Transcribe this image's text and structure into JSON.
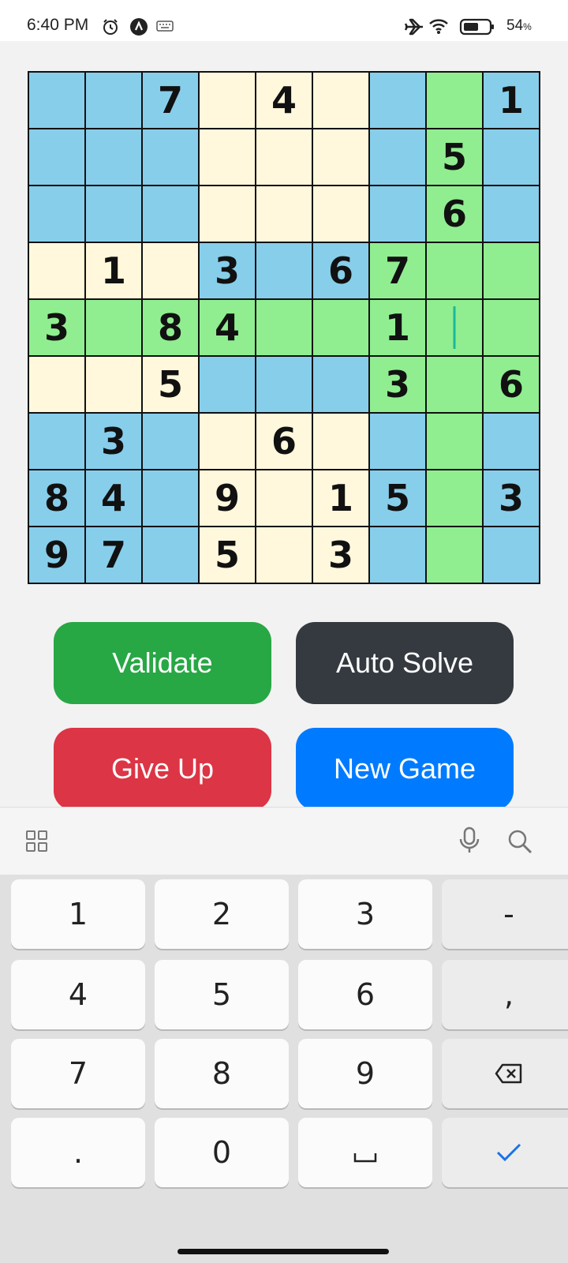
{
  "status_bar": {
    "time": "6:40 PM",
    "battery_percent": "54",
    "battery_unit": "%",
    "icons": [
      "alarm-icon",
      "notification-a-icon",
      "keyboard-icon",
      "airplane-icon",
      "wifi-icon",
      "battery-icon"
    ]
  },
  "board": {
    "rows": [
      [
        "",
        "",
        "7",
        "",
        "4",
        "",
        "",
        "",
        "1"
      ],
      [
        "",
        "",
        "",
        "",
        "",
        "",
        "",
        "5",
        ""
      ],
      [
        "",
        "",
        "",
        "",
        "",
        "",
        "",
        "6",
        ""
      ],
      [
        "",
        "1",
        "",
        "3",
        "",
        "6",
        "7",
        "",
        ""
      ],
      [
        "3",
        "",
        "8",
        "4",
        "",
        "",
        "1",
        "",
        ""
      ],
      [
        "",
        "",
        "5",
        "",
        "",
        "",
        "3",
        "",
        "6"
      ],
      [
        "",
        "3",
        "",
        "",
        "6",
        "",
        "",
        "",
        ""
      ],
      [
        "8",
        "4",
        "",
        "9",
        "",
        "1",
        "5",
        "",
        "3"
      ],
      [
        "9",
        "7",
        "",
        "5",
        "",
        "3",
        "",
        "",
        ""
      ]
    ],
    "colors": [
      [
        "b",
        "b",
        "b",
        "c",
        "c",
        "c",
        "b",
        "g",
        "b"
      ],
      [
        "b",
        "b",
        "b",
        "c",
        "c",
        "c",
        "b",
        "g",
        "b"
      ],
      [
        "b",
        "b",
        "b",
        "c",
        "c",
        "c",
        "b",
        "g",
        "b"
      ],
      [
        "c",
        "c",
        "c",
        "b",
        "b",
        "b",
        "g",
        "g",
        "g"
      ],
      [
        "g",
        "g",
        "g",
        "g",
        "g",
        "g",
        "g",
        "g",
        "g"
      ],
      [
        "c",
        "c",
        "c",
        "b",
        "b",
        "b",
        "g",
        "g",
        "g"
      ],
      [
        "b",
        "b",
        "b",
        "c",
        "c",
        "c",
        "b",
        "g",
        "b"
      ],
      [
        "b",
        "b",
        "b",
        "c",
        "c",
        "c",
        "b",
        "g",
        "b"
      ],
      [
        "b",
        "b",
        "b",
        "c",
        "c",
        "c",
        "b",
        "g",
        "b"
      ]
    ],
    "color_map": {
      "b": "#87ceeb",
      "c": "#fff8dc",
      "g": "#90ee90"
    },
    "focused_cell": [
      4,
      7
    ]
  },
  "buttons": {
    "validate": "Validate",
    "auto_solve": "Auto Solve",
    "give_up": "Give Up",
    "new_game": "New Game",
    "colors": {
      "validate": "#28a745",
      "auto_solve": "#343a40",
      "give_up": "#dc3545",
      "new_game": "#007bff"
    }
  },
  "keyboard": {
    "toolbar_icons": [
      "grid-menu-icon",
      "microphone-icon",
      "search-icon"
    ],
    "keys": [
      [
        "1",
        "2",
        "3",
        "-"
      ],
      [
        "4",
        "5",
        "6",
        ","
      ],
      [
        "7",
        "8",
        "9",
        "backspace-icon"
      ],
      [
        ".",
        "0",
        "space-icon",
        "checkmark-icon"
      ]
    ]
  }
}
